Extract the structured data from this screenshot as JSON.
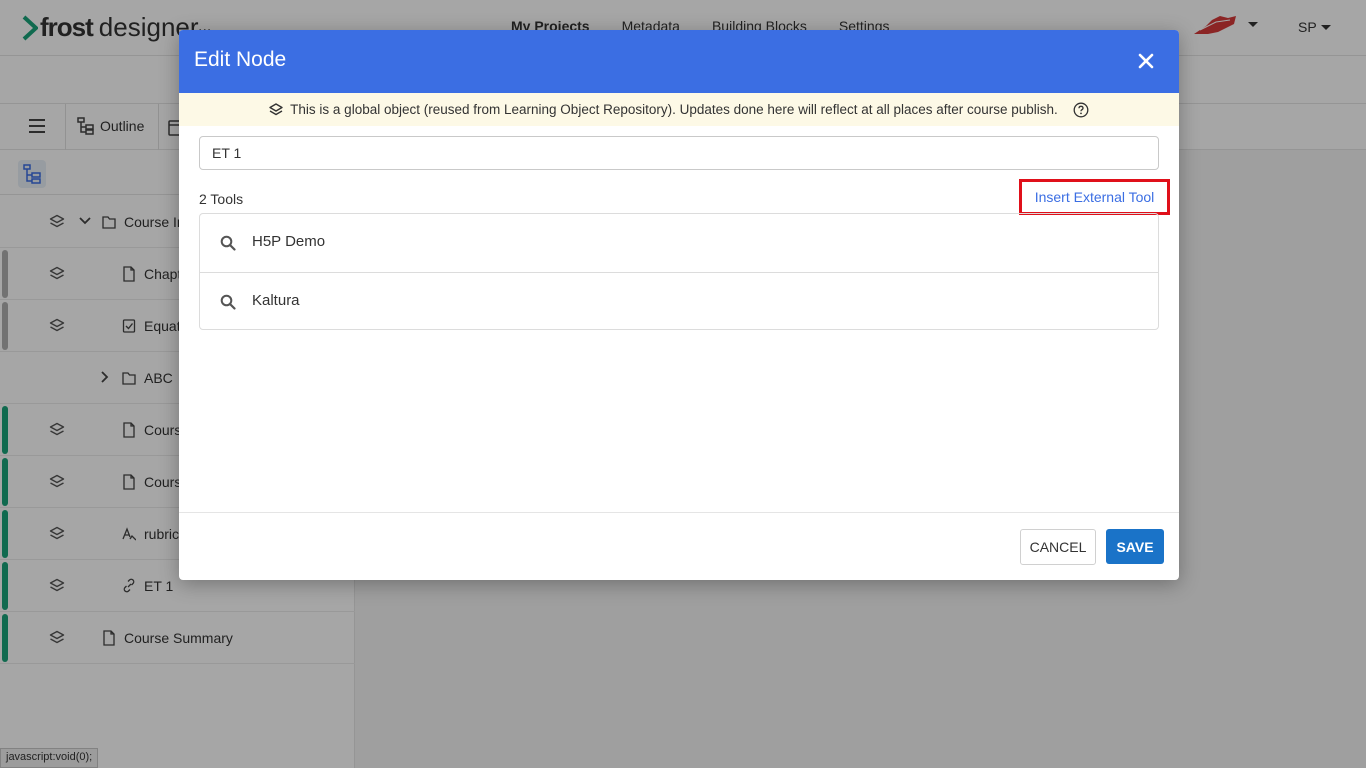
{
  "app": {
    "logo_bold": "frost",
    "logo_light": "designer",
    "more_label": "...",
    "nav": [
      "My Projects",
      "Metadata",
      "Building Blocks",
      "Settings"
    ],
    "active_nav": "My Projects",
    "user_initials": "SP"
  },
  "toolbar": {
    "outline_label": "Outline"
  },
  "tree": [
    {
      "label": "Course Intro",
      "icon": "folder-icon",
      "bar": "",
      "indent": 1,
      "expandable": "expanded"
    },
    {
      "label": "Chapter",
      "icon": "page-icon",
      "bar": "#b0b0b0",
      "indent": 2
    },
    {
      "label": "Equations",
      "icon": "checkbox-icon",
      "bar": "#b0b0b0",
      "indent": 2
    },
    {
      "label": "ABC",
      "icon": "folder-icon",
      "bar": "",
      "indent": 2,
      "expandable": "collapsed",
      "no_layers": true
    },
    {
      "label": "Course",
      "icon": "page-icon",
      "bar": "#1aa37a",
      "indent": 2
    },
    {
      "label": "Course",
      "icon": "page-icon",
      "bar": "#1aa37a",
      "indent": 2
    },
    {
      "label": "rubric",
      "icon": "rubric-icon",
      "bar": "#1aa37a",
      "indent": 2
    },
    {
      "label": "ET 1",
      "icon": "link-icon",
      "bar": "#1aa37a",
      "indent": 2
    },
    {
      "label": "Course Summary",
      "icon": "page-icon",
      "bar": "#1aa37a",
      "indent": 1
    }
  ],
  "status_bar": "javascript:void(0);",
  "modal": {
    "title": "Edit Node",
    "notice": "This is a global object (reused from Learning Object Repository). Updates done here will reflect at all places after course publish.",
    "name_value": "ET 1",
    "tools_count": "2 Tools",
    "insert_link": "Insert External Tool",
    "tools": [
      {
        "name": "H5P Demo"
      },
      {
        "name": "Kaltura"
      }
    ],
    "cancel_label": "CANCEL",
    "save_label": "SAVE"
  },
  "colors": {
    "header_blue": "#3b6ee3",
    "save_blue": "#1a73c8",
    "notice_bg": "#fdf9e6",
    "highlight_red": "#e0101a",
    "published_green": "#1aa37a"
  }
}
